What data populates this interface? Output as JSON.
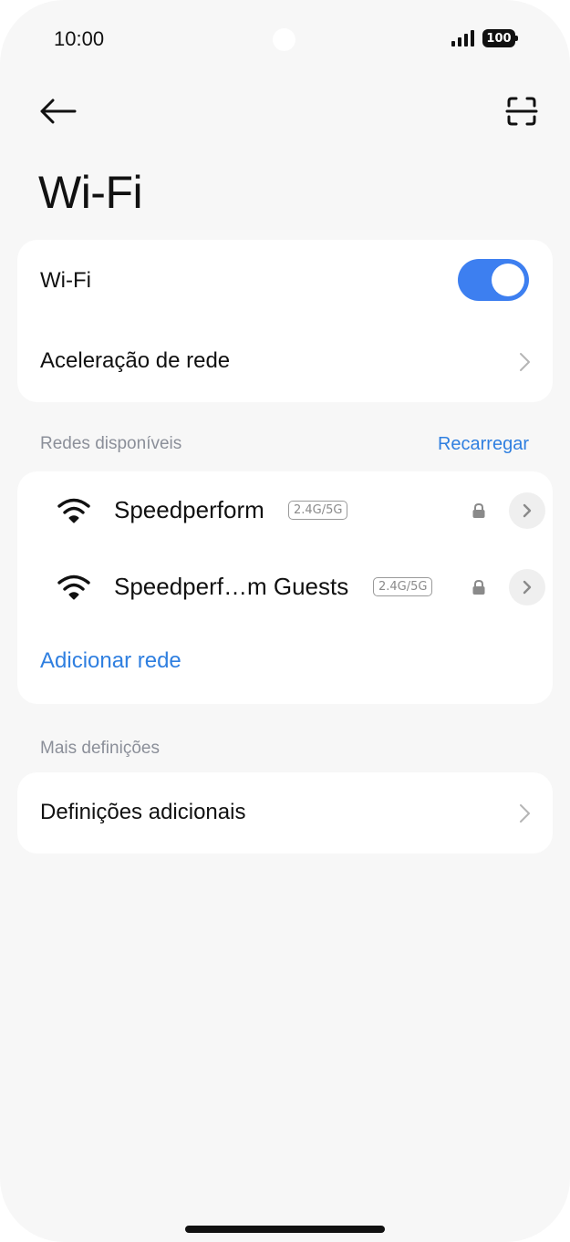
{
  "status_bar": {
    "time": "10:00",
    "battery": "100",
    "icons": [
      "signal-icon",
      "battery-icon"
    ]
  },
  "app_bar": {
    "back_icon": "arrow-left-icon",
    "scan_icon": "qr-scan-icon"
  },
  "page": {
    "title": "Wi-Fi"
  },
  "wifi_card": {
    "wifi_label": "Wi-Fi",
    "wifi_enabled": true,
    "network_acceleration_label": "Aceleração de rede"
  },
  "available_networks": {
    "section_label": "Redes disponíveis",
    "reload_label": "Recarregar",
    "networks": [
      {
        "name": "Speedperform",
        "band": "2.4G/5G",
        "secured": true
      },
      {
        "name": "Speedperf…m Guests",
        "band": "2.4G/5G",
        "secured": true
      }
    ],
    "add_network_label": "Adicionar rede"
  },
  "more_settings": {
    "section_label": "Mais definições",
    "additional_settings_label": "Definições adicionais"
  },
  "colors": {
    "accent": "#3d7ff0",
    "link": "#2f7fe0",
    "background": "#f7f7f7",
    "card": "#ffffff",
    "section_label": "#8b8f99"
  }
}
